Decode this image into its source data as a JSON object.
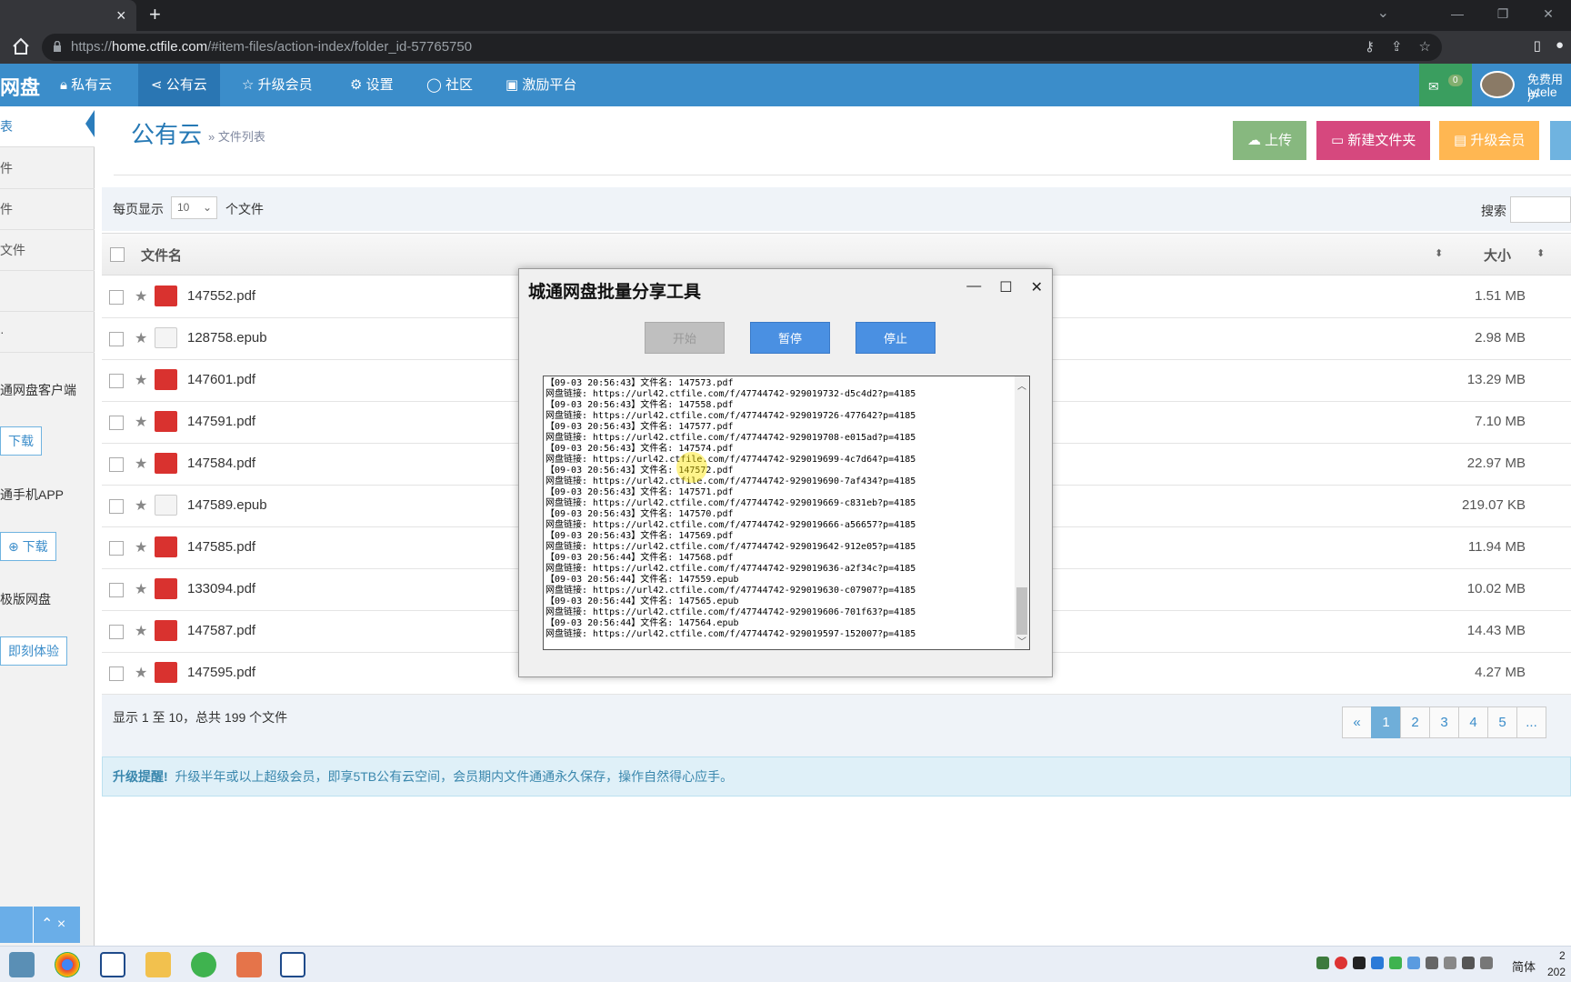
{
  "browser": {
    "tab_close": "×",
    "new_tab": "+",
    "url_prefix": "https://",
    "url_host": "home.ctfile.com",
    "url_path": "/#item-files/action-index/folder_id-57765750"
  },
  "nav": {
    "brand": "网盘",
    "items": [
      "私有云",
      "公有云",
      "升级会员",
      "设置",
      "社区",
      "激励平台"
    ],
    "msg_count": "0",
    "user_type": "免费用户",
    "user_name": "lytele"
  },
  "sidebar": {
    "items": [
      "表",
      "件",
      "件",
      "文件",
      "",
      "·"
    ],
    "client_text": "通网盘客户端",
    "download1": "下载",
    "mobile_text": "通手机APP",
    "download2": "下载",
    "web_text": "极版网盘",
    "try_btn": "即刻体验",
    "float_icons": "⌃ ×"
  },
  "main": {
    "title": "公有云",
    "breadcrumb": "» 文件列表",
    "actions": {
      "upload": "上传",
      "new_folder": "新建文件夹",
      "upgrade": "升级会员"
    },
    "per_page_label": "每页显示",
    "per_page_value": "10",
    "per_page_unit": "个文件",
    "search_label": "搜索",
    "col_name": "文件名",
    "col_size": "大小",
    "files": [
      {
        "name": "147552.pdf",
        "type": "pdf",
        "size": "1.51 MB"
      },
      {
        "name": "128758.epub",
        "type": "epub",
        "size": "2.98 MB"
      },
      {
        "name": "147601.pdf",
        "type": "pdf",
        "size": "13.29 MB"
      },
      {
        "name": "147591.pdf",
        "type": "pdf",
        "size": "7.10 MB"
      },
      {
        "name": "147584.pdf",
        "type": "pdf",
        "size": "22.97 MB"
      },
      {
        "name": "147589.epub",
        "type": "epub",
        "size": "219.07 KB"
      },
      {
        "name": "147585.pdf",
        "type": "pdf",
        "size": "11.94 MB"
      },
      {
        "name": "133094.pdf",
        "type": "pdf",
        "size": "10.02 MB"
      },
      {
        "name": "147587.pdf",
        "type": "pdf",
        "size": "14.43 MB"
      },
      {
        "name": "147595.pdf",
        "type": "pdf",
        "size": "4.27 MB"
      }
    ],
    "footer_info": "显示 1 至 10，总共 199 个文件",
    "pager": [
      "«",
      "1",
      "2",
      "3",
      "4",
      "5",
      "..."
    ],
    "pager_current": "1",
    "notice_bold": "升级提醒!",
    "notice_text": "升级半年或以上超级会员，即享5TB公有云空间，会员期内文件通通永久保存，操作自然得心应手。"
  },
  "dialog": {
    "title": "城通网盘批量分享工具",
    "start": "开始",
    "pause": "暂停",
    "stop": "停止",
    "log": [
      "【09-03 20:56:43】文件名: 147573.pdf",
      "网盘链接: https://url42.ctfile.com/f/47744742-929019732-d5c4d2?p=4185",
      "【09-03 20:56:43】文件名: 147558.pdf",
      "网盘链接: https://url42.ctfile.com/f/47744742-929019726-477642?p=4185",
      "【09-03 20:56:43】文件名: 147577.pdf",
      "网盘链接: https://url42.ctfile.com/f/47744742-929019708-e015ad?p=4185",
      "【09-03 20:56:43】文件名: 147574.pdf",
      "网盘链接: https://url42.ctfile.com/f/47744742-929019699-4c7d64?p=4185",
      "【09-03 20:56:43】文件名: 147572.pdf",
      "网盘链接: https://url42.ctfile.com/f/47744742-929019690-7af434?p=4185",
      "【09-03 20:56:43】文件名: 147571.pdf",
      "网盘链接: https://url42.ctfile.com/f/47744742-929019669-c831eb?p=4185",
      "【09-03 20:56:43】文件名: 147570.pdf",
      "网盘链接: https://url42.ctfile.com/f/47744742-929019666-a56657?p=4185",
      "【09-03 20:56:43】文件名: 147569.pdf",
      "网盘链接: https://url42.ctfile.com/f/47744742-929019642-912e05?p=4185",
      "【09-03 20:56:44】文件名: 147568.pdf",
      "网盘链接: https://url42.ctfile.com/f/47744742-929019636-a2f34c?p=4185",
      "【09-03 20:56:44】文件名: 147559.epub",
      "网盘链接: https://url42.ctfile.com/f/47744742-929019630-c07907?p=4185",
      "【09-03 20:56:44】文件名: 147565.epub",
      "网盘链接: https://url42.ctfile.com/f/47744742-929019606-701f63?p=4185",
      "【09-03 20:56:44】文件名: 147564.epub",
      "网盘链接: https://url42.ctfile.com/f/47744742-929019597-152007?p=4185"
    ]
  },
  "taskbar": {
    "lang": "简体",
    "clock_top": "2",
    "clock_bottom": "202"
  }
}
